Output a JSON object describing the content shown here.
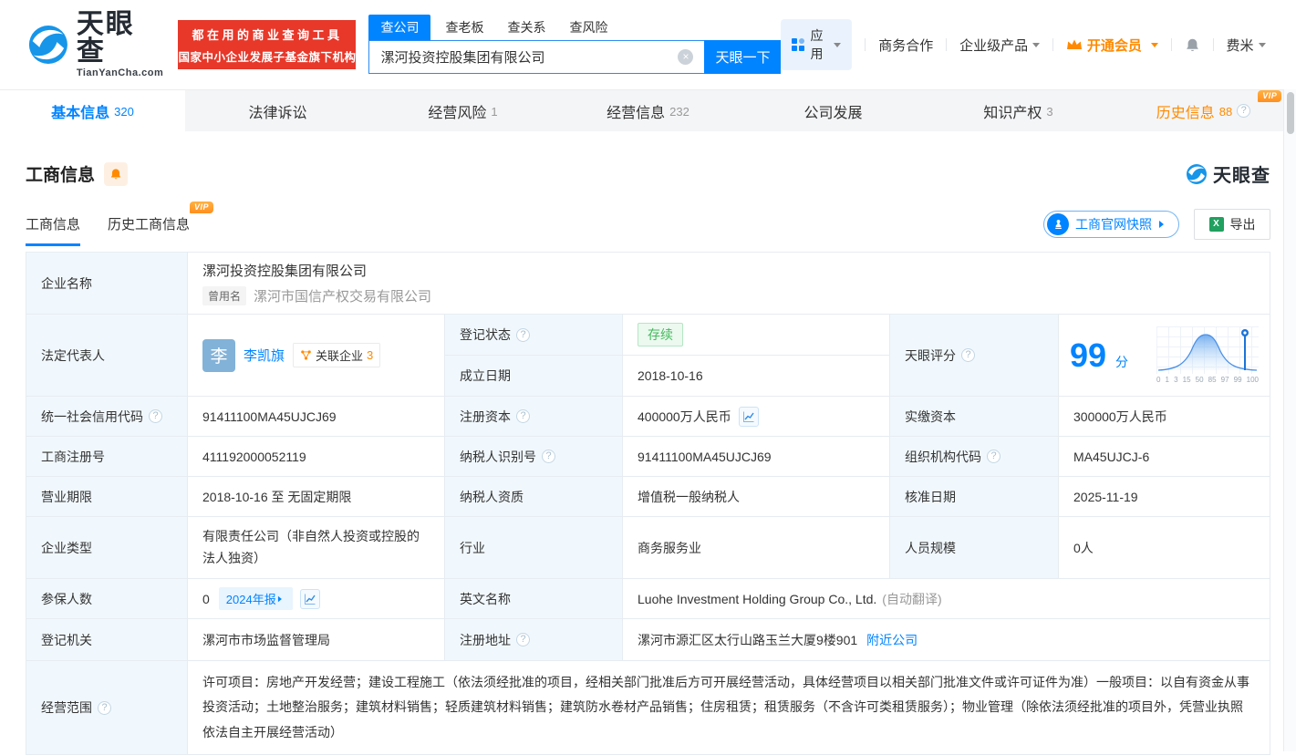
{
  "colors": {
    "accent_blue": "#0084ff",
    "vip_orange": "#ff8a00",
    "status_green": "#45b95c",
    "banner_red": "#e7382a"
  },
  "icons": {
    "clear": "×",
    "help": "?",
    "excel": "X"
  },
  "badges": {
    "vip": "VIP"
  },
  "header": {
    "logo": {
      "cn": "天眼查",
      "domain": "TianYanCha.com"
    },
    "slogan": {
      "line1": "都在用的商业查询工具",
      "line2": "国家中小企业发展子基金旗下机构"
    },
    "search": {
      "tabs": [
        {
          "label": "查公司",
          "active": true
        },
        {
          "label": "查老板",
          "active": false
        },
        {
          "label": "查关系",
          "active": false
        },
        {
          "label": "查风险",
          "active": false
        }
      ],
      "value": "漯河投资控股集团有限公司",
      "button": "天眼一下"
    },
    "nav": {
      "apps": "应用",
      "cooperation": "商务合作",
      "enterprise": "企业级产品",
      "vip": "开通会员",
      "user": "费米"
    }
  },
  "page_tabs": [
    {
      "label": "基本信息",
      "count": "320"
    },
    {
      "label": "法律诉讼",
      "count": ""
    },
    {
      "label": "经营风险",
      "count": "1"
    },
    {
      "label": "经营信息",
      "count": "232"
    },
    {
      "label": "公司发展",
      "count": ""
    },
    {
      "label": "知识产权",
      "count": "3"
    },
    {
      "label": "历史信息",
      "count": "88"
    }
  ],
  "section": {
    "title": "工商信息",
    "brand": "天眼查",
    "sub_tabs": [
      {
        "label": "工商信息"
      },
      {
        "label": "历史工商信息"
      }
    ],
    "snapshot_button": "工商官网快照",
    "export_button": "导出"
  },
  "table": {
    "company_name_label": "企业名称",
    "company_name": "漯河投资控股集团有限公司",
    "former_name_badge": "曾用名",
    "former_name": "漯河市国信产权交易有限公司",
    "legal_rep_label": "法定代表人",
    "legal_rep_avatar": "李",
    "legal_rep_name": "李凯旗",
    "related_companies": "关联企业",
    "related_companies_count": "3",
    "reg_status_label": "登记状态",
    "reg_status": "存续",
    "establish_date_label": "成立日期",
    "establish_date": "2018-10-16",
    "score_label": "天眼评分",
    "score_value": "99",
    "score_unit": "分",
    "score_ticks": [
      "0",
      "1",
      "3",
      "15",
      "50",
      "85",
      "97",
      "99",
      "100"
    ],
    "credit_code_label": "统一社会信用代码",
    "credit_code": "91411100MA45UJCJ69",
    "reg_capital_label": "注册资本",
    "reg_capital": "400000万人民币",
    "paid_capital_label": "实缴资本",
    "paid_capital": "300000万人民币",
    "reg_number_label": "工商注册号",
    "reg_number": "411192000052119",
    "taxpayer_id_label": "纳税人识别号",
    "taxpayer_id": "91411100MA45UJCJ69",
    "org_code_label": "组织机构代码",
    "org_code": "MA45UJCJ-6",
    "business_term_label": "营业期限",
    "business_term": "2018-10-16 至 无固定期限",
    "taxpayer_quality_label": "纳税人资质",
    "taxpayer_quality": "增值税一般纳税人",
    "approval_date_label": "核准日期",
    "approval_date": "2025-11-19",
    "company_type_label": "企业类型",
    "company_type": "有限责任公司（非自然人投资或控股的法人独资）",
    "industry_label": "行业",
    "industry": "商务服务业",
    "staff_size_label": "人员规模",
    "staff_size": "0人",
    "insured_label": "参保人数",
    "insured": "0",
    "annual_report_badge": "2024年报",
    "english_name_label": "英文名称",
    "english_name": "Luohe Investment Holding Group Co., Ltd.",
    "english_name_note": "(自动翻译)",
    "reg_authority_label": "登记机关",
    "reg_authority": "漯河市市场监督管理局",
    "address_label": "注册地址",
    "address": "漯河市源汇区太行山路玉兰大厦9楼901",
    "nearby_link": "附近公司",
    "business_scope_label": "经营范围",
    "business_scope": "许可项目：房地产开发经营；建设工程施工（依法须经批准的项目，经相关部门批准后方可开展经营活动，具体经营项目以相关部门批准文件或许可证件为准）一般项目：以自有资金从事投资活动；土地整治服务；建筑材料销售；轻质建筑材料销售；建筑防水卷材产品销售；住房租赁；租赁服务（不含许可类租赁服务）；物业管理（除依法须经批准的项目外，凭营业执照依法自主开展经营活动）"
  }
}
